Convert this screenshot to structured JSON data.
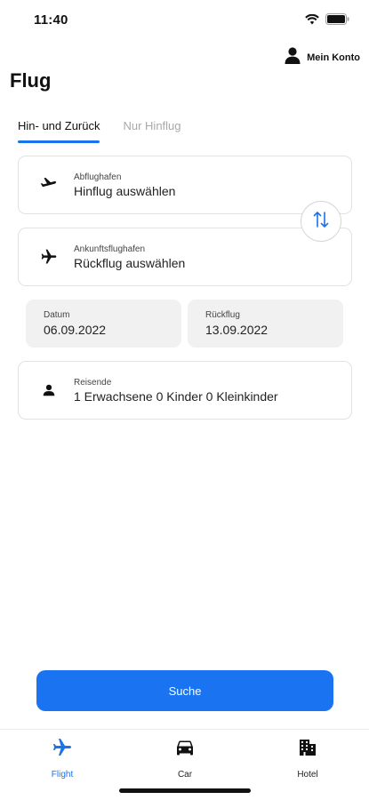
{
  "status": {
    "time": "11:40"
  },
  "account": {
    "label": "Mein Konto"
  },
  "page": {
    "title": "Flug"
  },
  "tabs": [
    {
      "label": "Hin- und Zurück",
      "active": true
    },
    {
      "label": "Nur Hinflug",
      "active": false
    }
  ],
  "fields": {
    "departure": {
      "label": "Abflughafen",
      "value": "Hinflug auswählen",
      "icon": "plane-takeoff-icon"
    },
    "arrival": {
      "label": "Ankunftsflughafen",
      "value": "Rückflug auswählen",
      "icon": "plane-icon"
    },
    "swap_icon": "swap-vertical-icon",
    "travelers": {
      "label": "Reisende",
      "value": "1 Erwachsene 0 Kinder 0 Kleinkinder",
      "icon": "person-icon"
    }
  },
  "dates": {
    "departure": {
      "label": "Datum",
      "value": "06.09.2022"
    },
    "return": {
      "label": "Rückflug",
      "value": "13.09.2022"
    }
  },
  "search": {
    "label": "Suche"
  },
  "bottom_nav": [
    {
      "label": "Flight",
      "icon": "plane-icon",
      "active": true
    },
    {
      "label": "Car",
      "icon": "car-icon",
      "active": false
    },
    {
      "label": "Hotel",
      "icon": "hotel-icon",
      "active": false
    }
  ],
  "colors": {
    "accent": "#1a73e8",
    "button": "#1a73f0",
    "date_bg": "#f1f1f1",
    "inactive_tab": "#a9a9a9"
  }
}
